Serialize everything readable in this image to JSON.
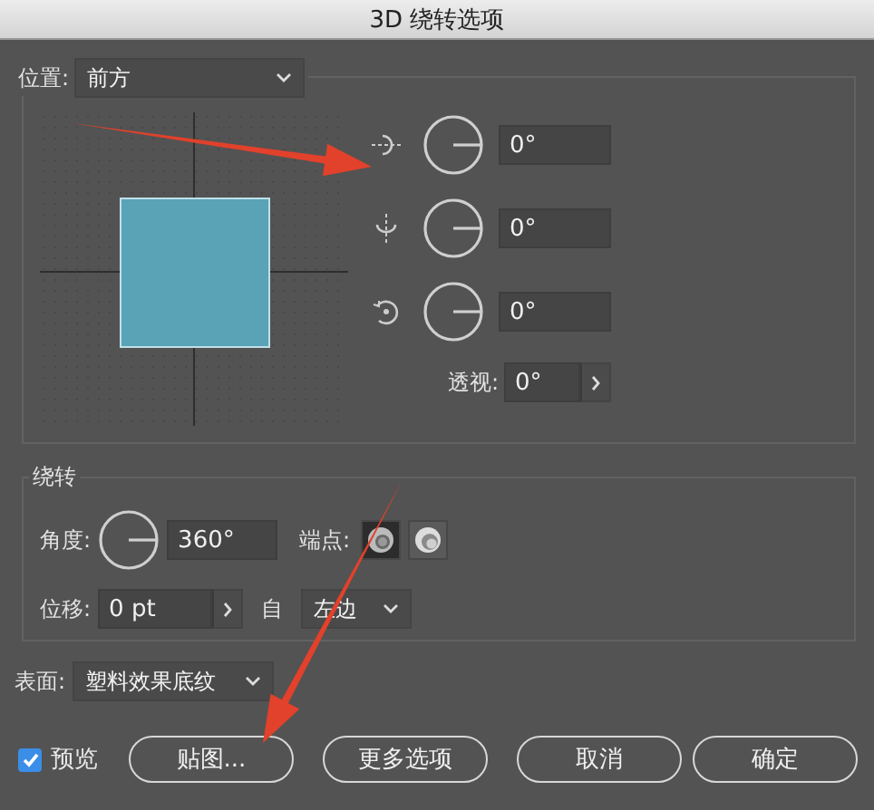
{
  "window": {
    "title": "3D 绕转选项"
  },
  "position": {
    "label": "位置:",
    "value": "前方"
  },
  "rotation": {
    "axes": [
      {
        "kind": "x",
        "value": "0°"
      },
      {
        "kind": "y",
        "value": "0°"
      },
      {
        "kind": "z",
        "value": "0°"
      }
    ],
    "perspective": {
      "label": "透视:",
      "value": "0°"
    }
  },
  "revolve": {
    "title": "绕转",
    "angle": {
      "label": "角度:",
      "value": "360°"
    },
    "cap": {
      "label": "端点:",
      "options": [
        {
          "kind": "solid",
          "selected": true
        },
        {
          "kind": "hollow",
          "selected": false
        }
      ]
    },
    "offset": {
      "label": "位移:",
      "value": "0 pt"
    },
    "from": {
      "label": "自",
      "value": "左边"
    }
  },
  "surface": {
    "label": "表面:",
    "value": "塑料效果底纹"
  },
  "preview": {
    "label": "预览",
    "checked": true
  },
  "buttons": [
    "贴图...",
    "更多选项",
    "取消",
    "确定"
  ],
  "annotations": [
    {
      "kind": "arrow"
    },
    {
      "kind": "arrow"
    }
  ]
}
